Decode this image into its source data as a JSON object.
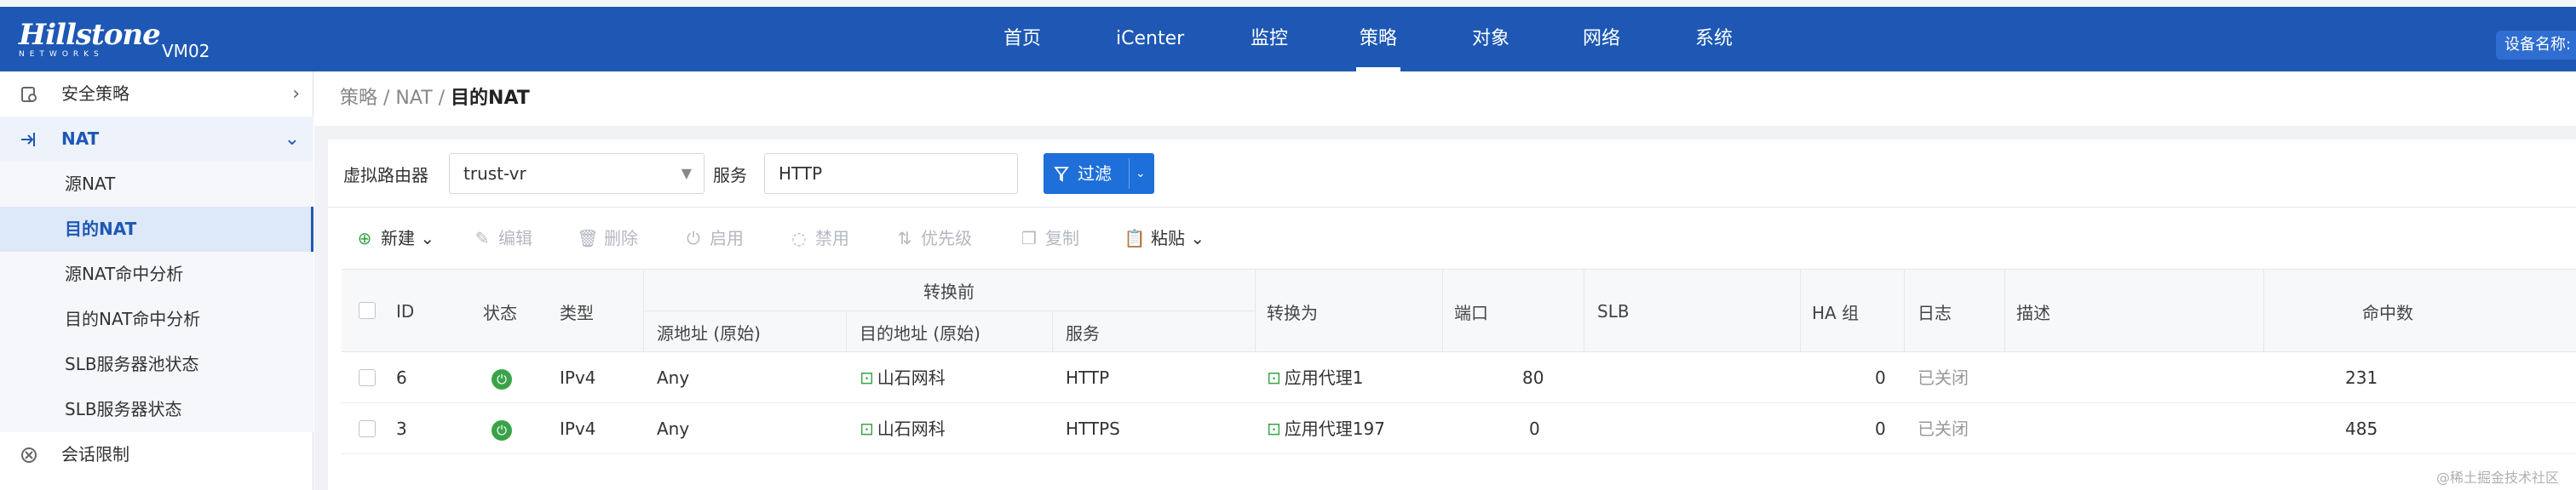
{
  "header": {
    "brand": "Hillstone",
    "brand_sub": "NETWORKS",
    "device": "VM02",
    "nav": [
      "首页",
      "iCenter",
      "监控",
      "策略",
      "对象",
      "网络",
      "系统"
    ],
    "active_nav": "策略",
    "device_name_label": "设备名称:"
  },
  "sidebar": {
    "security_policy": "安全策略",
    "nat_group": "NAT",
    "items": [
      "源NAT",
      "目的NAT",
      "源NAT命中分析",
      "目的NAT命中分析",
      "SLB服务器池状态",
      "SLB服务器状态"
    ],
    "active_item": "目的NAT",
    "session_limit": "会话限制"
  },
  "breadcrumb": {
    "path": "策略 / NAT / ",
    "current": "目的NAT"
  },
  "filters": {
    "vrouter_label": "虚拟路由器",
    "vrouter_value": "trust-vr",
    "service_label": "服务",
    "service_value": "HTTP",
    "filter_button": "过滤"
  },
  "toolbar": {
    "new": "新建",
    "edit": "编辑",
    "delete": "删除",
    "enable": "启用",
    "disable": "禁用",
    "priority": "优先级",
    "copy": "复制",
    "paste": "粘贴"
  },
  "table": {
    "headers": {
      "id": "ID",
      "status": "状态",
      "type": "类型",
      "before_group": "转换前",
      "src": "源地址 (原始)",
      "dst": "目的地址 (原始)",
      "service": "服务",
      "translate_to": "转换为",
      "port": "端口",
      "slb": "SLB",
      "ha": "HA 组",
      "log": "日志",
      "desc": "描述",
      "hits": "命中数"
    },
    "rows": [
      {
        "id": "6",
        "type": "IPv4",
        "src": "Any",
        "dst": "山石网科",
        "service": "HTTP",
        "translate": "应用代理1",
        "port": "80",
        "ha": "0",
        "log": "已关闭",
        "hits": "231"
      },
      {
        "id": "3",
        "type": "IPv4",
        "src": "Any",
        "dst": "山石网科",
        "service": "HTTPS",
        "translate": "应用代理197",
        "port": "0",
        "ha": "0",
        "log": "已关闭",
        "hits": "485"
      }
    ]
  },
  "watermark": "@稀土掘金技术社区"
}
